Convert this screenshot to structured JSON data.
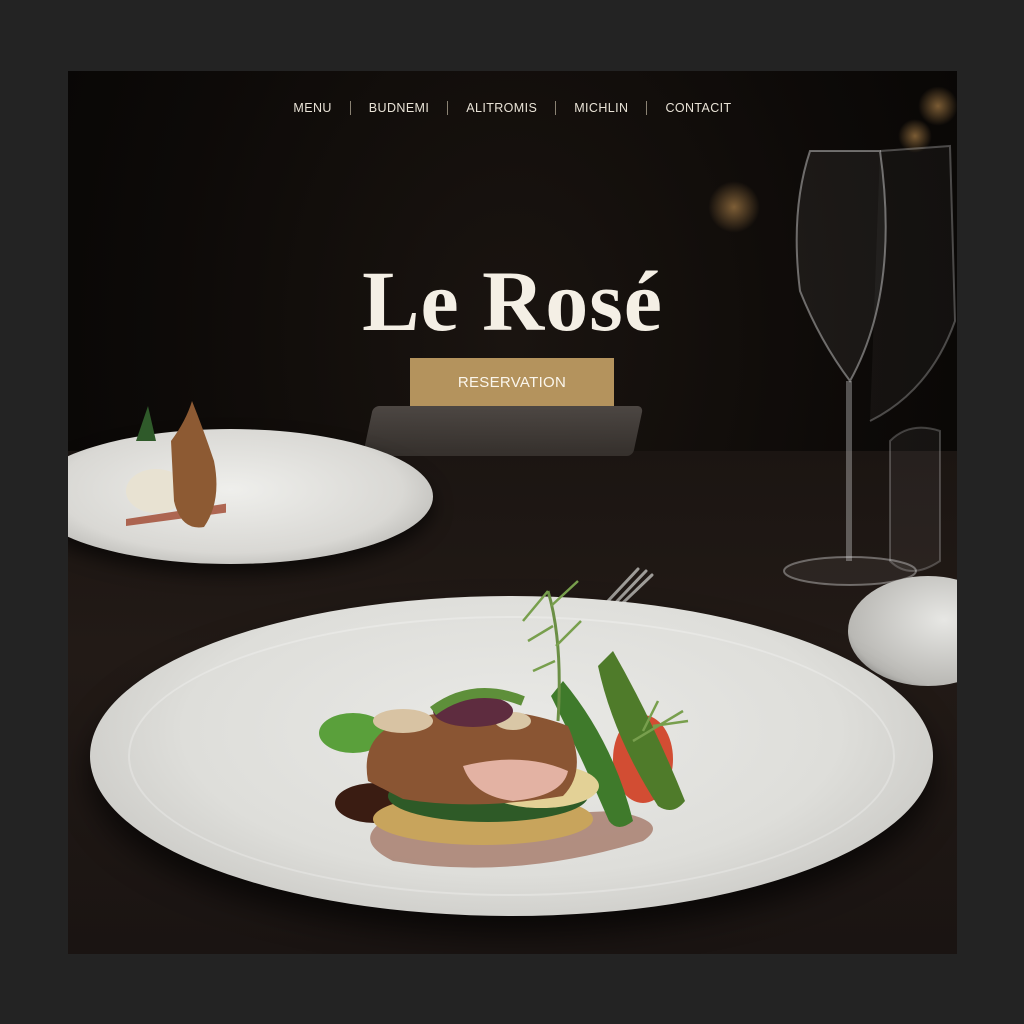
{
  "nav": {
    "items": [
      {
        "label": "MENU"
      },
      {
        "label": "BUDNEMI"
      },
      {
        "label": "ALITROMIS"
      },
      {
        "label": "MICHLIN"
      },
      {
        "label": "CONTACIT"
      }
    ]
  },
  "hero": {
    "brand": "Le Rosé",
    "cta_label": "RESERVATION"
  },
  "colors": {
    "background": "#232323",
    "accent_button": "#b4935d",
    "text_light": "#f4efe5"
  }
}
